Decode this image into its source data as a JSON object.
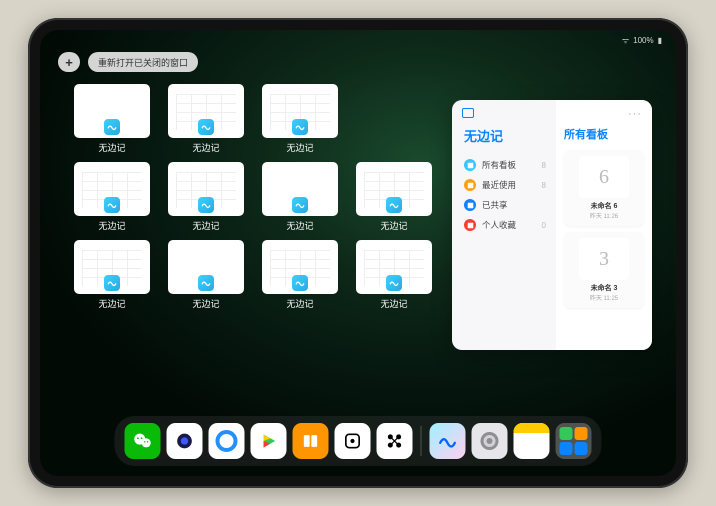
{
  "status": {
    "battery": "100%",
    "wifi": "●●●"
  },
  "topbar": {
    "plus": "+",
    "reopen_label": "重新打开已关闭的窗口"
  },
  "app_name": "无边记",
  "windows": [
    {
      "label": "无边记",
      "style": "blank"
    },
    {
      "label": "无边记",
      "style": "grid"
    },
    {
      "label": "无边记",
      "style": "grid-stack"
    },
    {
      "label": "无边记",
      "style": "blank"
    },
    {
      "label": "无边记",
      "style": "grid"
    },
    {
      "label": "无边记",
      "style": "grid-stack"
    },
    {
      "label": "无边记",
      "style": "blank"
    },
    {
      "label": "无边记",
      "style": "grid"
    },
    {
      "label": "无边记",
      "style": "grid-stack"
    },
    {
      "label": "无边记",
      "style": "blank"
    },
    {
      "label": "无边记",
      "style": "grid"
    },
    {
      "label": "无边记",
      "style": "grid-stack"
    }
  ],
  "panel": {
    "more": "···",
    "left_title": "无边记",
    "right_title": "所有看板",
    "menu": [
      {
        "label": "所有看板",
        "count": "8",
        "color": "#34c8ff"
      },
      {
        "label": "最近使用",
        "count": "8",
        "color": "#ff9f0a"
      },
      {
        "label": "已共享",
        "count": "",
        "color": "#0a84ff"
      },
      {
        "label": "个人收藏",
        "count": "0",
        "color": "#ff3b30"
      }
    ],
    "boards": [
      {
        "glyph": "6",
        "title": "未命名 6",
        "sub": "昨天 11:26"
      },
      {
        "glyph": "3",
        "title": "未命名 3",
        "sub": "昨天 11:25"
      }
    ]
  },
  "dock": [
    {
      "name": "wechat",
      "bg": "#09bb07"
    },
    {
      "name": "quark",
      "bg": "#ffffff"
    },
    {
      "name": "qqbrowser",
      "bg": "#2490ff"
    },
    {
      "name": "play",
      "bg": "#ffffff"
    },
    {
      "name": "books",
      "bg": "#ff9500"
    },
    {
      "name": "dice",
      "bg": "#ffffff"
    },
    {
      "name": "connect",
      "bg": "#ffffff"
    },
    {
      "name": "freeform",
      "bg": "gradient"
    },
    {
      "name": "settings",
      "bg": "#8e8e93"
    },
    {
      "name": "notes",
      "bg": "#ffffff"
    }
  ]
}
